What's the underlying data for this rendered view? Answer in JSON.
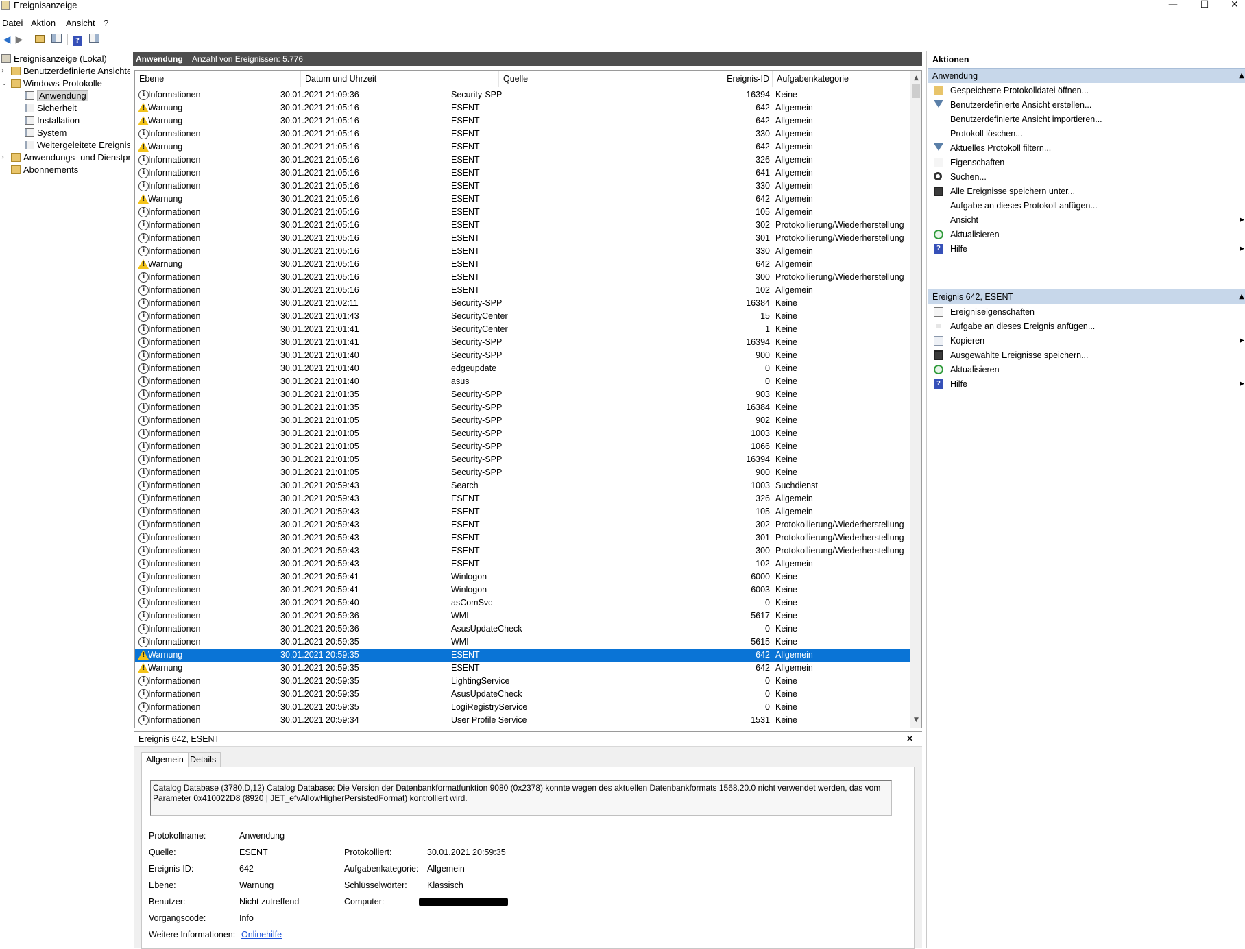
{
  "window": {
    "title": "Ereignisanzeige",
    "minimize": "—",
    "maximize": "☐",
    "close": "✕"
  },
  "menu": [
    "Datei",
    "Aktion",
    "Ansicht",
    "?"
  ],
  "toolbar": {
    "icons": [
      "back-arrow-icon",
      "forward-arrow-icon",
      "up-folder-icon",
      "show-hide-tree-icon",
      "help-icon",
      "show-hide-actions-icon"
    ]
  },
  "tree": {
    "root": "Ereignisanzeige (Lokal)",
    "custom_views": "Benutzerdefinierte Ansichten",
    "windows_logs": "Windows-Protokolle",
    "logs": [
      "Anwendung",
      "Sicherheit",
      "Installation",
      "System",
      "Weitergeleitete Ereignisse"
    ],
    "app_services": "Anwendungs- und Dienstprotokolle",
    "subscriptions": "Abonnements"
  },
  "center": {
    "log_name": "Anwendung",
    "count_label": "Anzahl von Ereignissen: 5.776",
    "columns": [
      "Ebene",
      "Datum und Uhrzeit",
      "Quelle",
      "Ereignis-ID",
      "Aufgabenkategorie"
    ],
    "rows": [
      [
        "Informationen",
        "30.01.2021 21:09:36",
        "Security-SPP",
        "16394",
        "Keine"
      ],
      [
        "Warnung",
        "30.01.2021 21:05:16",
        "ESENT",
        "642",
        "Allgemein"
      ],
      [
        "Warnung",
        "30.01.2021 21:05:16",
        "ESENT",
        "642",
        "Allgemein"
      ],
      [
        "Informationen",
        "30.01.2021 21:05:16",
        "ESENT",
        "330",
        "Allgemein"
      ],
      [
        "Warnung",
        "30.01.2021 21:05:16",
        "ESENT",
        "642",
        "Allgemein"
      ],
      [
        "Informationen",
        "30.01.2021 21:05:16",
        "ESENT",
        "326",
        "Allgemein"
      ],
      [
        "Informationen",
        "30.01.2021 21:05:16",
        "ESENT",
        "641",
        "Allgemein"
      ],
      [
        "Informationen",
        "30.01.2021 21:05:16",
        "ESENT",
        "330",
        "Allgemein"
      ],
      [
        "Warnung",
        "30.01.2021 21:05:16",
        "ESENT",
        "642",
        "Allgemein"
      ],
      [
        "Informationen",
        "30.01.2021 21:05:16",
        "ESENT",
        "105",
        "Allgemein"
      ],
      [
        "Informationen",
        "30.01.2021 21:05:16",
        "ESENT",
        "302",
        "Protokollierung/Wiederherstellung"
      ],
      [
        "Informationen",
        "30.01.2021 21:05:16",
        "ESENT",
        "301",
        "Protokollierung/Wiederherstellung"
      ],
      [
        "Informationen",
        "30.01.2021 21:05:16",
        "ESENT",
        "330",
        "Allgemein"
      ],
      [
        "Warnung",
        "30.01.2021 21:05:16",
        "ESENT",
        "642",
        "Allgemein"
      ],
      [
        "Informationen",
        "30.01.2021 21:05:16",
        "ESENT",
        "300",
        "Protokollierung/Wiederherstellung"
      ],
      [
        "Informationen",
        "30.01.2021 21:05:16",
        "ESENT",
        "102",
        "Allgemein"
      ],
      [
        "Informationen",
        "30.01.2021 21:02:11",
        "Security-SPP",
        "16384",
        "Keine"
      ],
      [
        "Informationen",
        "30.01.2021 21:01:43",
        "SecurityCenter",
        "15",
        "Keine"
      ],
      [
        "Informationen",
        "30.01.2021 21:01:41",
        "SecurityCenter",
        "1",
        "Keine"
      ],
      [
        "Informationen",
        "30.01.2021 21:01:41",
        "Security-SPP",
        "16394",
        "Keine"
      ],
      [
        "Informationen",
        "30.01.2021 21:01:40",
        "Security-SPP",
        "900",
        "Keine"
      ],
      [
        "Informationen",
        "30.01.2021 21:01:40",
        "edgeupdate",
        "0",
        "Keine"
      ],
      [
        "Informationen",
        "30.01.2021 21:01:40",
        "asus",
        "0",
        "Keine"
      ],
      [
        "Informationen",
        "30.01.2021 21:01:35",
        "Security-SPP",
        "903",
        "Keine"
      ],
      [
        "Informationen",
        "30.01.2021 21:01:35",
        "Security-SPP",
        "16384",
        "Keine"
      ],
      [
        "Informationen",
        "30.01.2021 21:01:05",
        "Security-SPP",
        "902",
        "Keine"
      ],
      [
        "Informationen",
        "30.01.2021 21:01:05",
        "Security-SPP",
        "1003",
        "Keine"
      ],
      [
        "Informationen",
        "30.01.2021 21:01:05",
        "Security-SPP",
        "1066",
        "Keine"
      ],
      [
        "Informationen",
        "30.01.2021 21:01:05",
        "Security-SPP",
        "16394",
        "Keine"
      ],
      [
        "Informationen",
        "30.01.2021 21:01:05",
        "Security-SPP",
        "900",
        "Keine"
      ],
      [
        "Informationen",
        "30.01.2021 20:59:43",
        "Search",
        "1003",
        "Suchdienst"
      ],
      [
        "Informationen",
        "30.01.2021 20:59:43",
        "ESENT",
        "326",
        "Allgemein"
      ],
      [
        "Informationen",
        "30.01.2021 20:59:43",
        "ESENT",
        "105",
        "Allgemein"
      ],
      [
        "Informationen",
        "30.01.2021 20:59:43",
        "ESENT",
        "302",
        "Protokollierung/Wiederherstellung"
      ],
      [
        "Informationen",
        "30.01.2021 20:59:43",
        "ESENT",
        "301",
        "Protokollierung/Wiederherstellung"
      ],
      [
        "Informationen",
        "30.01.2021 20:59:43",
        "ESENT",
        "300",
        "Protokollierung/Wiederherstellung"
      ],
      [
        "Informationen",
        "30.01.2021 20:59:43",
        "ESENT",
        "102",
        "Allgemein"
      ],
      [
        "Informationen",
        "30.01.2021 20:59:41",
        "Winlogon",
        "6000",
        "Keine"
      ],
      [
        "Informationen",
        "30.01.2021 20:59:41",
        "Winlogon",
        "6003",
        "Keine"
      ],
      [
        "Informationen",
        "30.01.2021 20:59:40",
        "asComSvc",
        "0",
        "Keine"
      ],
      [
        "Informationen",
        "30.01.2021 20:59:36",
        "WMI",
        "5617",
        "Keine"
      ],
      [
        "Informationen",
        "30.01.2021 20:59:36",
        "AsusUpdateCheck",
        "0",
        "Keine"
      ],
      [
        "Informationen",
        "30.01.2021 20:59:35",
        "WMI",
        "5615",
        "Keine"
      ],
      [
        "Warnung",
        "30.01.2021 20:59:35",
        "ESENT",
        "642",
        "Allgemein"
      ],
      [
        "Warnung",
        "30.01.2021 20:59:35",
        "ESENT",
        "642",
        "Allgemein"
      ],
      [
        "Informationen",
        "30.01.2021 20:59:35",
        "LightingService",
        "0",
        "Keine"
      ],
      [
        "Informationen",
        "30.01.2021 20:59:35",
        "AsusUpdateCheck",
        "0",
        "Keine"
      ],
      [
        "Informationen",
        "30.01.2021 20:59:35",
        "LogiRegistryService",
        "0",
        "Keine"
      ],
      [
        "Informationen",
        "30.01.2021 20:59:34",
        "User Profile Service",
        "1531",
        "Keine"
      ]
    ],
    "selected_row": 43
  },
  "detail": {
    "title": "Ereignis 642, ESENT",
    "close": "✕",
    "tabs": [
      "Allgemein",
      "Details"
    ],
    "description": "Catalog Database (3780,D,12) Catalog Database: Die Version der Datenbankformatfunktion 9080 (0x2378) konnte wegen des aktuellen Datenbankformats 1568.20.0 nicht verwendet werden, das vom Parameter 0x410022D8 (8920 | JET_efvAllowHigherPersistedFormat) kontrolliert wird.",
    "labels": {
      "log_name": "Protokollname:",
      "source": "Quelle:",
      "event_id": "Ereignis-ID:",
      "level": "Ebene:",
      "user": "Benutzer:",
      "opcode": "Vorgangscode:",
      "more_info": "Weitere Informationen:",
      "logged": "Protokolliert:",
      "task_category": "Aufgabenkategorie:",
      "keywords": "Schlüsselwörter:",
      "computer": "Computer:"
    },
    "values": {
      "log_name": "Anwendung",
      "source": "ESENT",
      "event_id": "642",
      "level": "Warnung",
      "user": "Nicht zutreffend",
      "opcode": "Info",
      "more_info": "Onlinehilfe",
      "logged": "30.01.2021 20:59:35",
      "task_category": "Allgemein",
      "keywords": "Klassisch"
    }
  },
  "actions": {
    "title": "Aktionen",
    "section1": "Anwendung",
    "items1": [
      {
        "label": "Gespeicherte Protokolldatei öffnen...",
        "icon": "open-folder-icon"
      },
      {
        "label": "Benutzerdefinierte Ansicht erstellen...",
        "icon": "filter-icon"
      },
      {
        "label": "Benutzerdefinierte Ansicht importieren...",
        "icon": ""
      },
      {
        "label": "Protokoll löschen...",
        "icon": ""
      },
      {
        "label": "Aktuelles Protokoll filtern...",
        "icon": "filter-icon"
      },
      {
        "label": "Eigenschaften",
        "icon": "properties-icon"
      },
      {
        "label": "Suchen...",
        "icon": "find-icon"
      },
      {
        "label": "Alle Ereignisse speichern unter...",
        "icon": "save-icon"
      },
      {
        "label": "Aufgabe an dieses Protokoll anfügen...",
        "icon": ""
      },
      {
        "label": "Ansicht",
        "icon": "",
        "submenu": true
      },
      {
        "label": "Aktualisieren",
        "icon": "refresh-icon"
      },
      {
        "label": "Hilfe",
        "icon": "help-icon",
        "submenu": true
      }
    ],
    "section2": "Ereignis 642, ESENT",
    "items2": [
      {
        "label": "Ereigniseigenschaften",
        "icon": "properties-icon"
      },
      {
        "label": "Aufgabe an dieses Ereignis anfügen...",
        "icon": "task-icon"
      },
      {
        "label": "Kopieren",
        "icon": "copy-icon",
        "submenu": true
      },
      {
        "label": "Ausgewählte Ereignisse speichern...",
        "icon": "save-icon"
      },
      {
        "label": "Aktualisieren",
        "icon": "refresh-icon"
      },
      {
        "label": "Hilfe",
        "icon": "help-icon",
        "submenu": true
      }
    ]
  },
  "colors": {
    "selection": "#0a74d6",
    "header_bar": "#4e4e4e",
    "action_section": "#c7d7ea",
    "warning": "#f3c318",
    "link": "#1a4fd6"
  }
}
